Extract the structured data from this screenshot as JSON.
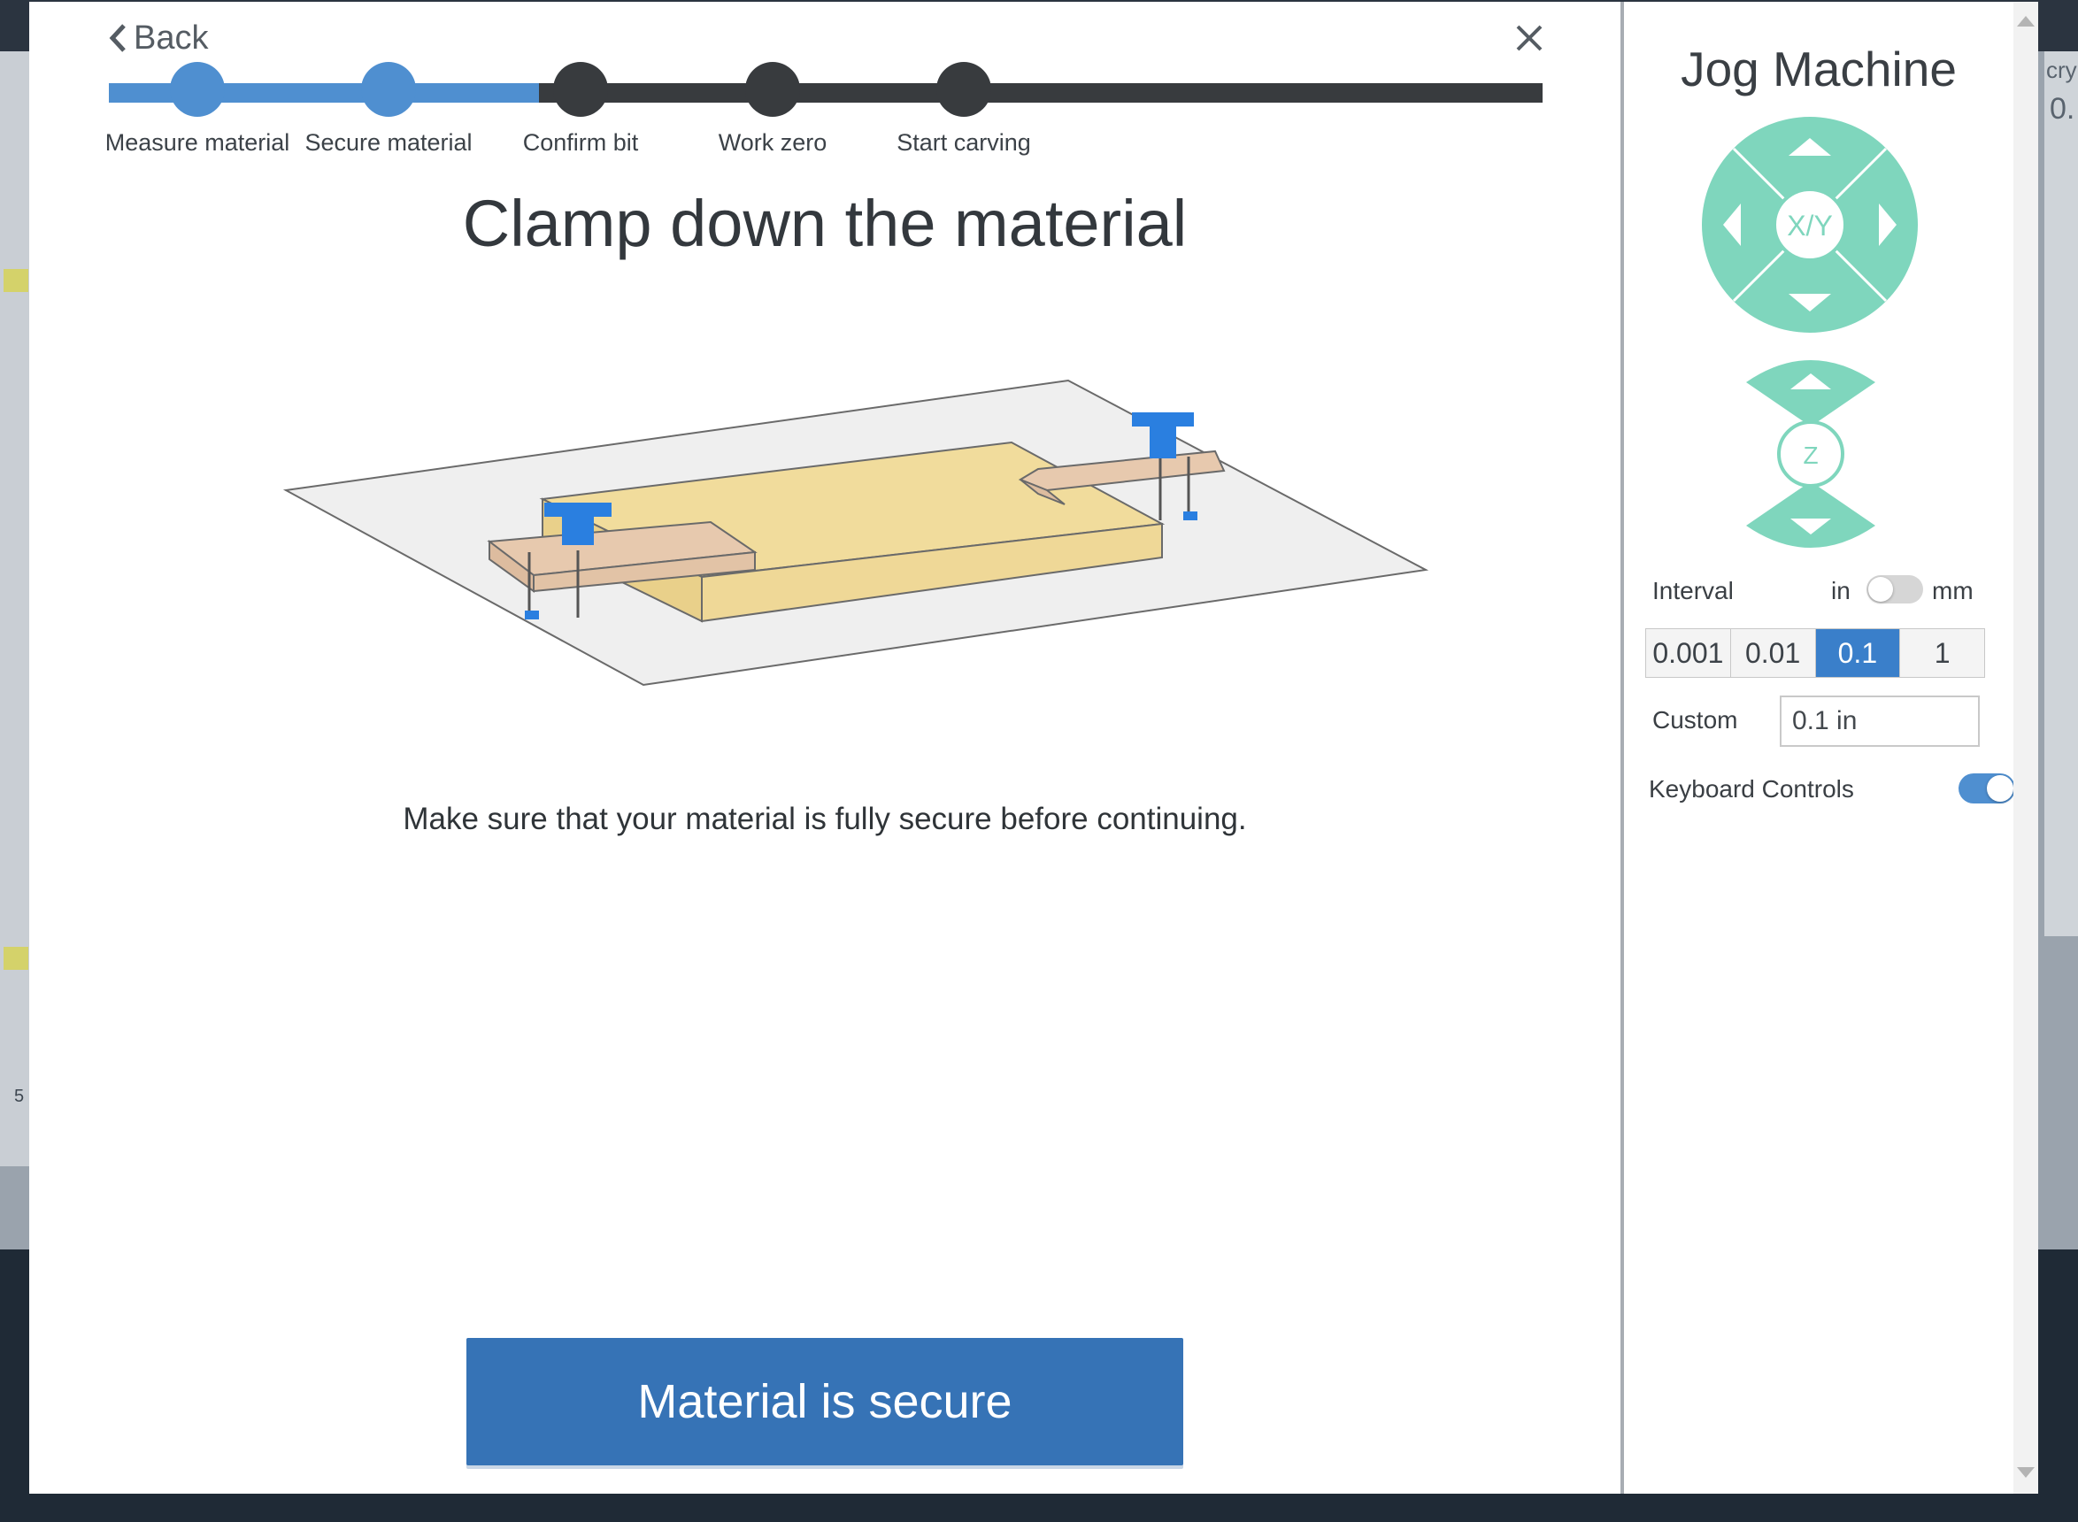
{
  "background": {
    "right_text_1": "cry",
    "right_text_2": "0.",
    "left_number": "5"
  },
  "modal": {
    "back_label": "Back",
    "steps": [
      {
        "label": "Measure material",
        "state": "done"
      },
      {
        "label": "Secure material",
        "state": "current"
      },
      {
        "label": "Confirm bit",
        "state": "pending"
      },
      {
        "label": "Work zero",
        "state": "pending"
      },
      {
        "label": "Start carving",
        "state": "pending"
      }
    ],
    "progress_fraction": 0.3,
    "title": "Clamp down the material",
    "instruction": "Make sure that your material is fully secure before continuing.",
    "primary_button": "Material is secure"
  },
  "jog": {
    "title": "Jog Machine",
    "xy_label": "X/Y",
    "z_label": "Z",
    "interval_label": "Interval",
    "unit_in": "in",
    "unit_mm": "mm",
    "unit_is_mm": false,
    "intervals": [
      "0.001",
      "0.01",
      "0.1",
      "1"
    ],
    "active_interval": "0.1",
    "custom_label": "Custom",
    "custom_value": "0.1 in",
    "keyboard_label": "Keyboard Controls",
    "keyboard_on": true
  },
  "colors": {
    "accent": "#4f8fd0",
    "button": "#3673b6",
    "jog_green": "#7fd6bd",
    "track_dark": "#383b3e"
  }
}
